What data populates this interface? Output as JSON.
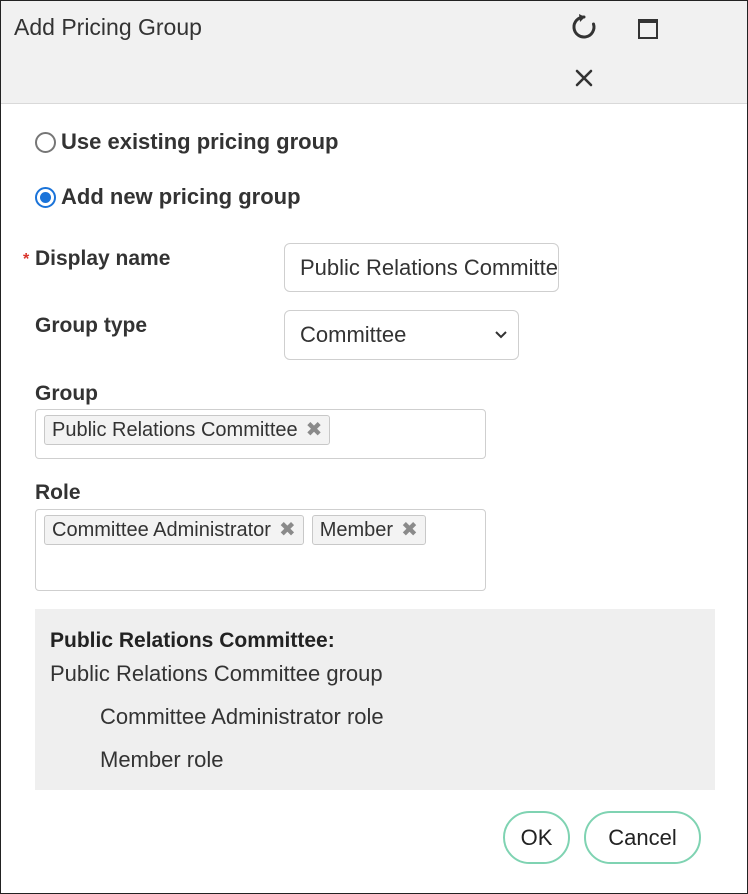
{
  "dialog": {
    "title": "Add Pricing Group"
  },
  "options": {
    "use_existing_label": "Use existing pricing group",
    "add_new_label": "Add new pricing group",
    "selected": "add_new"
  },
  "form": {
    "required_marker": "*",
    "display_name_label": "Display name",
    "display_name_value": "Public Relations Committee",
    "group_type_label": "Group type",
    "group_type_value": "Committee",
    "group_label": "Group",
    "group_tags": [
      "Public Relations Committee"
    ],
    "role_label": "Role",
    "role_tags": [
      "Committee Administrator",
      "Member"
    ]
  },
  "summary": {
    "title": "Public Relations Committee:",
    "group_line": "Public Relations Committee group",
    "role_lines": [
      "Committee Administrator role",
      "Member role"
    ]
  },
  "buttons": {
    "ok_label": "OK",
    "cancel_label": "Cancel"
  },
  "colors": {
    "accent_radio": "#1a73d9",
    "button_border": "#7fd3b2",
    "required": "#d9342b"
  },
  "icons": {
    "refresh": "refresh-icon",
    "maximize": "maximize-icon",
    "close": "close-icon",
    "select_chevron": "chevron-down-icon",
    "tag_remove": "remove-x-icon"
  }
}
